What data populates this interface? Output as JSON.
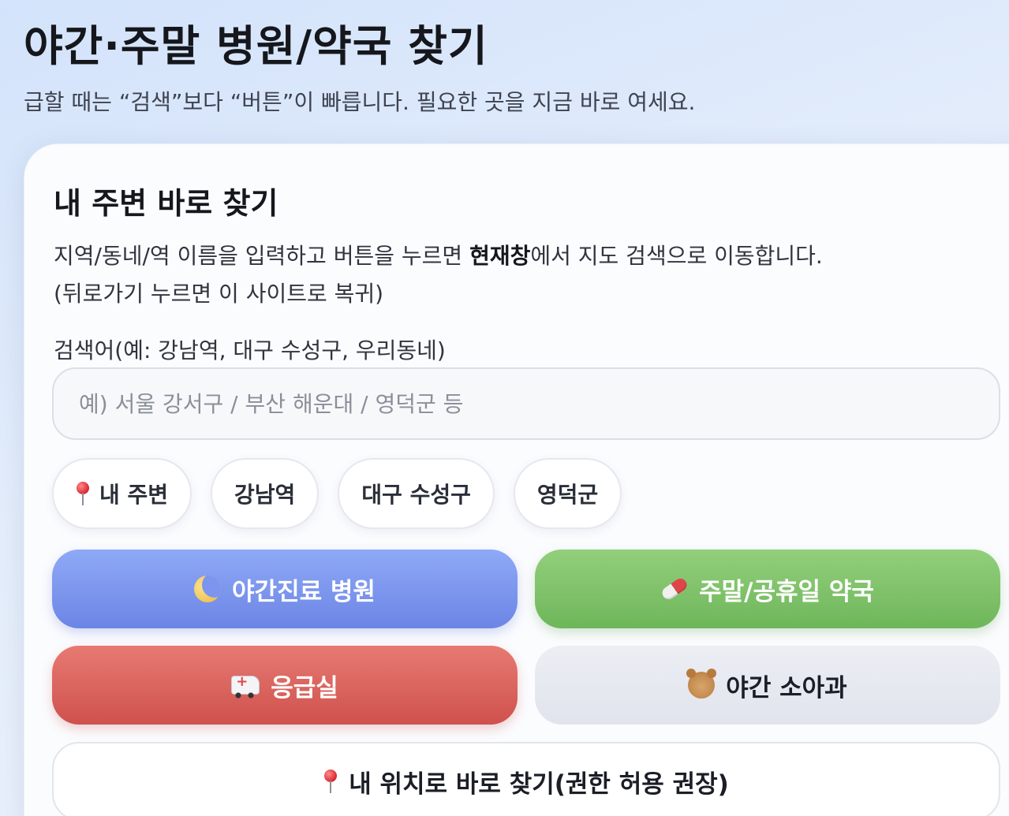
{
  "header": {
    "title": "야간·주말 병원/약국 찾기",
    "subtitle": "급할 때는 “검색”보다 “버튼”이 빠릅니다. 필요한 곳을 지금 바로 여세요."
  },
  "card": {
    "title": "내 주변 바로 찾기",
    "desc_line1_pre": "지역/동네/역 이름을 입력하고 버튼을 누르면 ",
    "desc_line1_bold": "현재창",
    "desc_line1_post": "에서 지도 검색으로 이동합니다.",
    "desc_line2": "(뒤로가기 누르면 이 사이트로 복귀)",
    "search_label": "검색어(예: 강남역, 대구 수성구, 우리동네)",
    "search_placeholder": "예) 서울 강서구 / 부산 해운대 / 영덕군 등",
    "search_value": ""
  },
  "chips": [
    {
      "label": "내 주변",
      "icon": "pin-icon"
    },
    {
      "label": "강남역"
    },
    {
      "label": "대구 수성구"
    },
    {
      "label": "영덕군"
    }
  ],
  "buttons": {
    "night_hospital": "야간진료 병원",
    "weekend_pharmacy": "주말/공휴일 약국",
    "emergency_room": "응급실",
    "night_pediatrics": "야간 소아과",
    "my_location": "내 위치로 바로 찾기(권한 허용 권장)"
  },
  "colors": {
    "night_button": "#7f98ee",
    "pharmacy_button": "#82c26b",
    "emergency_button": "#db6560",
    "pediatrics_button": "#e6e8ef"
  }
}
